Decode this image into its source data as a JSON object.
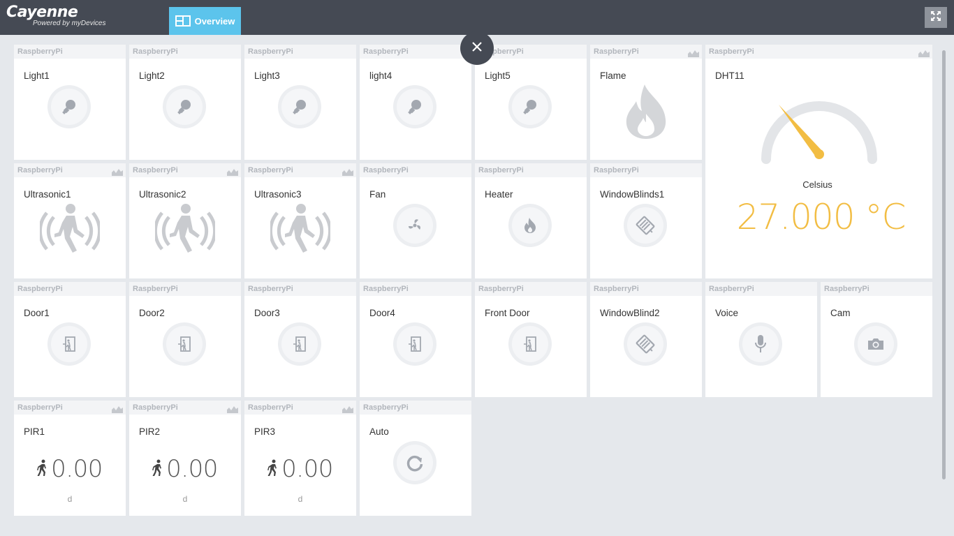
{
  "app": {
    "name": "Cayenne",
    "tagline": "Powered by myDevices"
  },
  "nav": {
    "tab_overview": "Overview"
  },
  "colors": {
    "topbar": "#454a54",
    "tab_active": "#5cc4ec",
    "gauge_accent": "#f2bd43",
    "icon_gray": "#a3a8b0"
  },
  "widgets": [
    {
      "device": "RaspberryPi",
      "title": "Light1",
      "icon": "lightbulb-icon",
      "chart": false
    },
    {
      "device": "RaspberryPi",
      "title": "Light2",
      "icon": "lightbulb-icon",
      "chart": false
    },
    {
      "device": "RaspberryPi",
      "title": "Light3",
      "icon": "lightbulb-icon",
      "chart": false
    },
    {
      "device": "RaspberryPi",
      "title": "light4",
      "icon": "lightbulb-icon",
      "chart": false
    },
    {
      "device": "RaspberryPi",
      "title": "Light5",
      "icon": "lightbulb-icon",
      "chart": false
    },
    {
      "device": "RaspberryPi",
      "title": "Flame",
      "icon": "flame-icon",
      "chart": true
    },
    {
      "device": "RaspberryPi",
      "title": "DHT11",
      "icon": "gauge",
      "chart": true,
      "unit_label": "Celsius",
      "value": "27.000 °C",
      "gauge_fraction": 0.3
    },
    {
      "device": "RaspberryPi",
      "title": "Ultrasonic1",
      "icon": "motion-sensor-icon",
      "chart": true
    },
    {
      "device": "RaspberryPi",
      "title": "Ultrasonic2",
      "icon": "motion-sensor-icon",
      "chart": true
    },
    {
      "device": "RaspberryPi",
      "title": "Ultrasonic3",
      "icon": "motion-sensor-icon",
      "chart": true
    },
    {
      "device": "RaspberryPi",
      "title": "Fan",
      "icon": "fan-icon",
      "chart": false
    },
    {
      "device": "RaspberryPi",
      "title": "Heater",
      "icon": "heater-flame-icon",
      "chart": false
    },
    {
      "device": "RaspberryPi",
      "title": "WindowBlinds1",
      "icon": "window-blinds-icon",
      "chart": false
    },
    {
      "device": "RaspberryPi",
      "title": "Door1",
      "icon": "door-icon",
      "chart": false
    },
    {
      "device": "RaspberryPi",
      "title": "Door2",
      "icon": "door-icon",
      "chart": false
    },
    {
      "device": "RaspberryPi",
      "title": "Door3",
      "icon": "door-icon",
      "chart": false
    },
    {
      "device": "RaspberryPi",
      "title": "Door4",
      "icon": "door-icon",
      "chart": false
    },
    {
      "device": "RaspberryPi",
      "title": "Front Door",
      "icon": "door-icon",
      "chart": false
    },
    {
      "device": "RaspberryPi",
      "title": "WindowBlind2",
      "icon": "window-blinds-icon",
      "chart": false
    },
    {
      "device": "RaspberryPi",
      "title": "Voice",
      "icon": "microphone-icon",
      "chart": false
    },
    {
      "device": "RaspberryPi",
      "title": "Cam",
      "icon": "camera-icon",
      "chart": false
    },
    {
      "device": "RaspberryPi",
      "title": "PIR1",
      "icon": "walking-person-icon",
      "chart": true,
      "value": "0.00",
      "unit": "d"
    },
    {
      "device": "RaspberryPi",
      "title": "PIR2",
      "icon": "walking-person-icon",
      "chart": true,
      "value": "0.00",
      "unit": "d"
    },
    {
      "device": "RaspberryPi",
      "title": "PIR3",
      "icon": "walking-person-icon",
      "chart": true,
      "value": "0.00",
      "unit": "d"
    },
    {
      "device": "RaspberryPi",
      "title": "Auto",
      "icon": "refresh-icon",
      "chart": false
    }
  ]
}
